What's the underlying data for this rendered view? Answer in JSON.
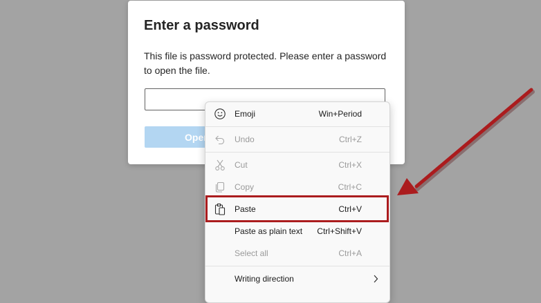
{
  "dialog": {
    "title": "Enter a password",
    "message": "This file is password protected. Please enter a password to open the file.",
    "password_value": "",
    "open_label": "Open"
  },
  "context_menu": {
    "items": [
      {
        "label": "Emoji",
        "shortcut": "Win+Period",
        "icon": "emoji-icon",
        "enabled": true
      },
      {
        "label": "Undo",
        "shortcut": "Ctrl+Z",
        "icon": "undo-icon",
        "enabled": false
      },
      {
        "label": "Cut",
        "shortcut": "Ctrl+X",
        "icon": "cut-icon",
        "enabled": false
      },
      {
        "label": "Copy",
        "shortcut": "Ctrl+C",
        "icon": "copy-icon",
        "enabled": false
      },
      {
        "label": "Paste",
        "shortcut": "Ctrl+V",
        "icon": "paste-icon",
        "enabled": true
      },
      {
        "label": "Paste as plain text",
        "shortcut": "Ctrl+Shift+V",
        "enabled": true
      },
      {
        "label": "Select all",
        "shortcut": "Ctrl+A",
        "enabled": false
      },
      {
        "label": "Writing direction",
        "icon": "chevron-right-icon",
        "enabled": true
      }
    ]
  },
  "annotation": {
    "highlight_color": "#ab1c1e",
    "arrow_color": "#ab1c1e",
    "target": "Paste"
  }
}
